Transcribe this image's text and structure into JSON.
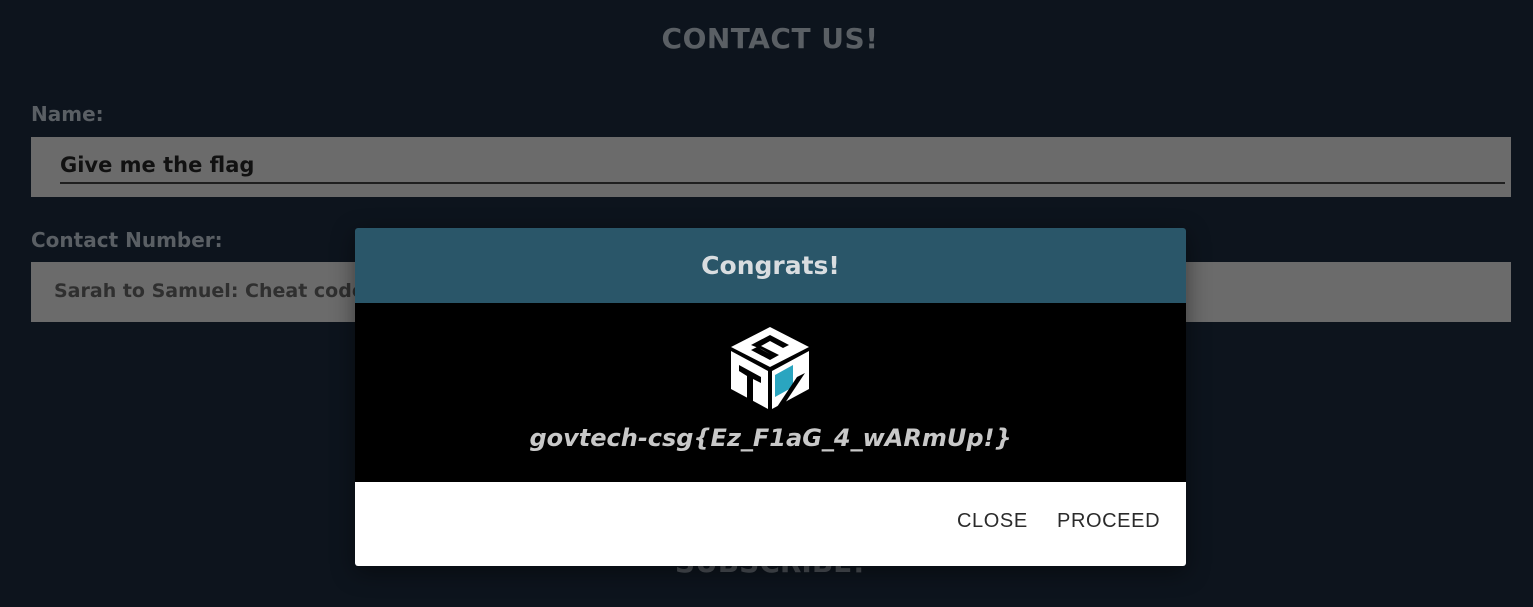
{
  "page": {
    "title": "CONTACT US!",
    "subscribe_heading": "SUBSCRIBE!"
  },
  "form": {
    "name_label": "Name:",
    "name_value": "Give me the flag",
    "contact_label": "Contact Number:",
    "contact_value": "Sarah to Samuel: Cheat code is a"
  },
  "modal": {
    "title": "Congrats!",
    "logo_icon": "stack-cube-logo-icon",
    "flag": "govtech-csg{Ez_F1aG_4_wARmUp!}",
    "close_label": "CLOSE",
    "proceed_label": "PROCEED"
  },
  "colors": {
    "background": "#0d141d",
    "modal_header": "#2a5669",
    "modal_body": "#000000",
    "logo_accent": "#2aa5c0"
  }
}
